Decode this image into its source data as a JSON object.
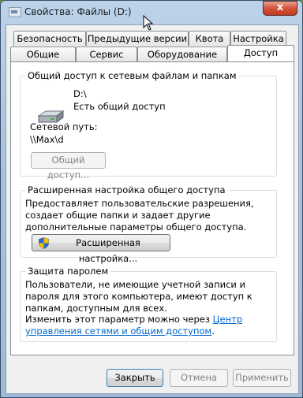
{
  "window": {
    "title": "Свойства: Файлы (D:)",
    "close_label": "x"
  },
  "tabs": {
    "row1": [
      "Безопасность",
      "Предыдущие версии",
      "Квота",
      "Настройка"
    ],
    "row2": [
      "Общие",
      "Сервис",
      "Оборудование",
      "Доступ"
    ],
    "active": "Доступ"
  },
  "share": {
    "title": "Общий доступ к сетевым файлам и папкам",
    "drive": "D:\\",
    "status": "Есть общий доступ",
    "path_label": "Сетевой путь:",
    "path_value": "\\\\Max\\d",
    "share_button": "Общий доступ..."
  },
  "advanced": {
    "title": "Расширенная настройка общего доступа",
    "description": "Предоставляет пользовательские разрешения, создает общие папки и задает другие дополнительные параметры общего доступа.",
    "button": "Расширенная настройка..."
  },
  "password": {
    "title": "Защита паролем",
    "description": "Пользователи, не имеющие учетной записи и пароля для этого компьютера, имеют доступ к папкам, доступным для всех.",
    "change_text": "Изменить этот параметр можно через",
    "link_text": "Центр управления сетями и общим доступом",
    "period": "."
  },
  "footer": {
    "close": "Закрыть",
    "cancel": "Отмена",
    "apply": "Применить"
  }
}
